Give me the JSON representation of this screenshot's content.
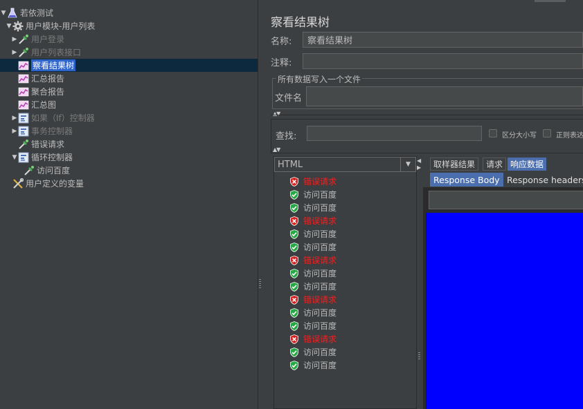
{
  "tree": {
    "items": [
      {
        "label": "若依测试",
        "icon": "test-plan-icon",
        "arrow": "▼",
        "disabled": false,
        "selected": false
      },
      {
        "label": "用户模块-用户列表",
        "icon": "thread-group-gear-icon",
        "arrow": "▼",
        "disabled": false,
        "selected": false
      },
      {
        "label": "用户登录",
        "icon": "http-sampler-dropper-icon",
        "arrow": "▶",
        "disabled": true,
        "selected": false
      },
      {
        "label": "用户列表接口",
        "icon": "http-sampler-dropper-icon",
        "arrow": "▶",
        "disabled": true,
        "selected": false
      },
      {
        "label": "察看结果树",
        "icon": "listener-chart-icon",
        "arrow": "",
        "disabled": false,
        "selected": true
      },
      {
        "label": "汇总报告",
        "icon": "listener-chart-icon",
        "arrow": "",
        "disabled": false,
        "selected": false
      },
      {
        "label": "聚合报告",
        "icon": "listener-chart-icon",
        "arrow": "",
        "disabled": false,
        "selected": false
      },
      {
        "label": "汇总图",
        "icon": "listener-chart-icon",
        "arrow": "",
        "disabled": false,
        "selected": false
      },
      {
        "label": "如果（If）控制器",
        "icon": "controller-icon",
        "arrow": "▶",
        "disabled": true,
        "selected": false
      },
      {
        "label": "事务控制器",
        "icon": "controller-icon",
        "arrow": "▶",
        "disabled": true,
        "selected": false
      },
      {
        "label": "错误请求",
        "icon": "http-sampler-dropper-icon",
        "arrow": "",
        "disabled": false,
        "selected": false
      },
      {
        "label": "循环控制器",
        "icon": "controller-icon",
        "arrow": "▼",
        "disabled": false,
        "selected": false
      },
      {
        "label": "访问百度",
        "icon": "http-sampler-dropper-icon",
        "arrow": "",
        "disabled": false,
        "selected": false
      },
      {
        "label": "用户定义的变量",
        "icon": "config-tools-icon",
        "arrow": "",
        "disabled": false,
        "selected": false
      }
    ]
  },
  "panel": {
    "title": "察看结果树",
    "name_label": "名称:",
    "name_value": "察看结果树",
    "comment_label": "注释:",
    "comment_value": "",
    "file_group_title": "所有数据写入一个文件",
    "file_label": "文件名",
    "file_value": "",
    "search_label": "查找:",
    "search_value": "",
    "case_sensitive_label": "区分大小写",
    "regex_label": "正则表达"
  },
  "results": {
    "renderer": "HTML",
    "items": [
      {
        "label": "错误请求",
        "status": "error"
      },
      {
        "label": "访问百度",
        "status": "ok"
      },
      {
        "label": "访问百度",
        "status": "ok"
      },
      {
        "label": "错误请求",
        "status": "error"
      },
      {
        "label": "访问百度",
        "status": "ok"
      },
      {
        "label": "访问百度",
        "status": "ok"
      },
      {
        "label": "错误请求",
        "status": "error"
      },
      {
        "label": "访问百度",
        "status": "ok"
      },
      {
        "label": "访问百度",
        "status": "ok"
      },
      {
        "label": "错误请求",
        "status": "error"
      },
      {
        "label": "访问百度",
        "status": "ok"
      },
      {
        "label": "访问百度",
        "status": "ok"
      },
      {
        "label": "错误请求",
        "status": "error"
      },
      {
        "label": "访问百度",
        "status": "ok"
      },
      {
        "label": "访问百度",
        "status": "ok"
      }
    ]
  },
  "detail": {
    "tabs": [
      {
        "label": "取样器结果",
        "active": false
      },
      {
        "label": "请求",
        "active": false
      },
      {
        "label": "响应数据",
        "active": true
      }
    ],
    "subtabs": [
      {
        "label": "Response Body",
        "active": true
      },
      {
        "label": "Response headers",
        "active": false
      }
    ]
  },
  "colors": {
    "error_text": "#ff1a1a",
    "selection": "#2f65ca",
    "response_body_bg": "#0000ff"
  }
}
